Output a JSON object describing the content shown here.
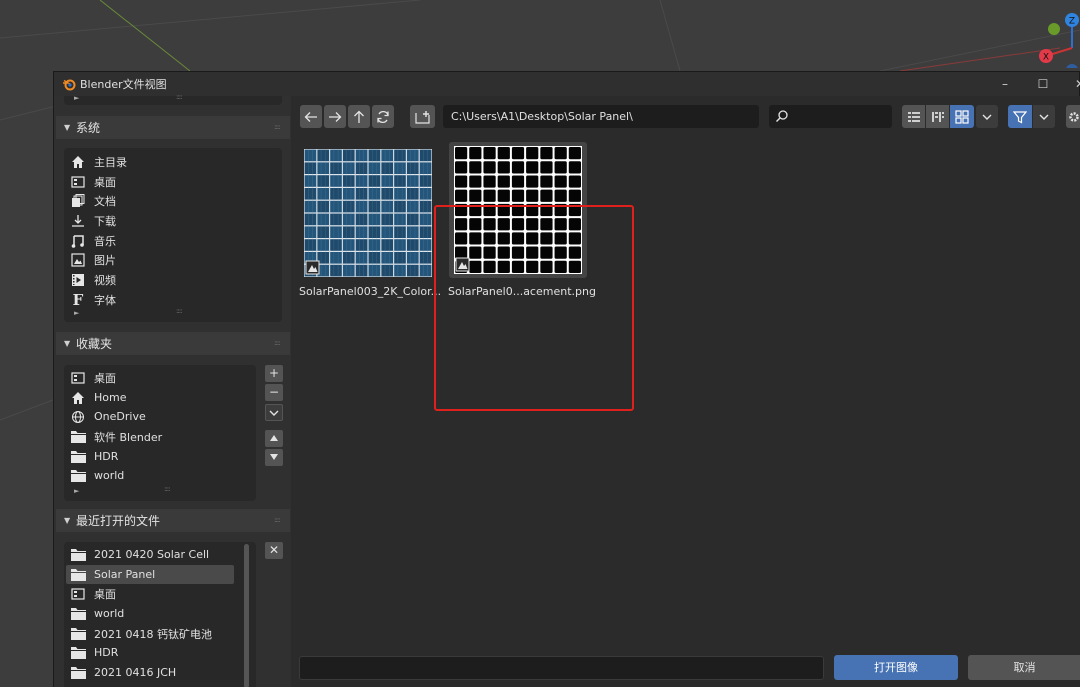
{
  "window": {
    "title": "Blender文件视图"
  },
  "sidebar": {
    "system": {
      "header": "系统",
      "items": [
        {
          "label": "主目录",
          "icon": "home-icon"
        },
        {
          "label": "桌面",
          "icon": "desktop-icon"
        },
        {
          "label": "文档",
          "icon": "documents-icon"
        },
        {
          "label": "下载",
          "icon": "download-icon"
        },
        {
          "label": "音乐",
          "icon": "music-icon"
        },
        {
          "label": "图片",
          "icon": "picture-icon"
        },
        {
          "label": "视频",
          "icon": "video-icon"
        },
        {
          "label": "字体",
          "icon": "font-icon"
        }
      ]
    },
    "bookmarks": {
      "header": "收藏夹",
      "items": [
        {
          "label": "桌面",
          "icon": "desktop-icon"
        },
        {
          "label": "Home",
          "icon": "home-icon"
        },
        {
          "label": "OneDrive",
          "icon": "network-icon"
        },
        {
          "label": "软件 Blender",
          "icon": "folder-icon"
        },
        {
          "label": "HDR",
          "icon": "folder-icon"
        },
        {
          "label": "world",
          "icon": "folder-icon"
        }
      ]
    },
    "recent": {
      "header": "最近打开的文件",
      "selected_index": 1,
      "items": [
        {
          "label": "2021 0420 Solar Cell",
          "icon": "folder-icon"
        },
        {
          "label": "Solar Panel",
          "icon": "folder-icon"
        },
        {
          "label": "桌面",
          "icon": "desktop-icon"
        },
        {
          "label": "world",
          "icon": "folder-icon"
        },
        {
          "label": "2021 0418 钙钛矿电池",
          "icon": "folder-icon"
        },
        {
          "label": "HDR",
          "icon": "folder-icon"
        },
        {
          "label": "2021 0416 JCH",
          "icon": "folder-icon"
        }
      ]
    }
  },
  "toolbar": {
    "path": "C:\\Users\\A1\\Desktop\\Solar Panel\\",
    "search_value": "",
    "display_mode": "thumbnails"
  },
  "files": [
    {
      "name": "SolarPanel003_2K_Color...",
      "kind": "color-texture"
    },
    {
      "name": "SolarPanel0...acement.png",
      "kind": "displacement-texture",
      "highlighted": true
    }
  ],
  "bottom": {
    "filename_value": "",
    "open_label": "打开图像",
    "cancel_label": "取消"
  },
  "colors": {
    "accent": "#4772b3",
    "highlight": "#e0201c",
    "panel_bg": "#303030",
    "field_bg": "#1d1d1d"
  }
}
